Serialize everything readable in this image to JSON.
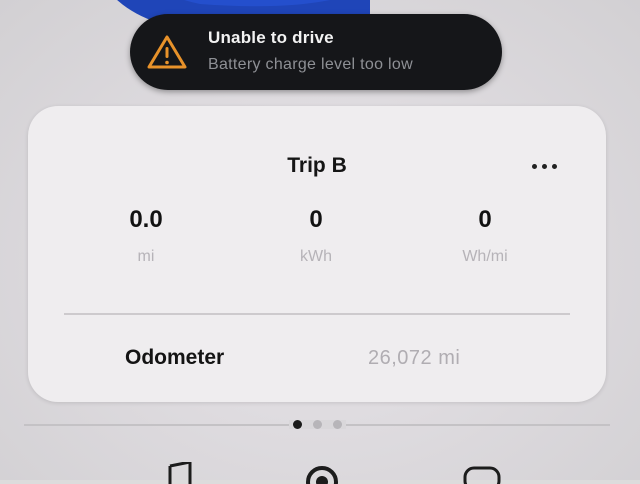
{
  "alert": {
    "icon": "warning-triangle-icon",
    "icon_color": "#e8922a",
    "title": "Unable to drive",
    "subtitle": "Battery charge level too low"
  },
  "card": {
    "title": "Trip B",
    "more_icon": "more-horizontal-icon",
    "stats": [
      {
        "value": "0.0",
        "unit": "mi"
      },
      {
        "value": "0",
        "unit": "kWh"
      },
      {
        "value": "0",
        "unit": "Wh/mi"
      }
    ],
    "odometer": {
      "label": "Odometer",
      "value": "26,072 mi"
    }
  },
  "pager": {
    "pages": 3,
    "active_index": 0
  },
  "dock": {
    "icons": [
      "music-note-icon",
      "camera-icon",
      "app-icon"
    ]
  },
  "colors": {
    "alert_background": "#151619",
    "card_background": "#efedef",
    "car_blue": "#1f45b8"
  }
}
